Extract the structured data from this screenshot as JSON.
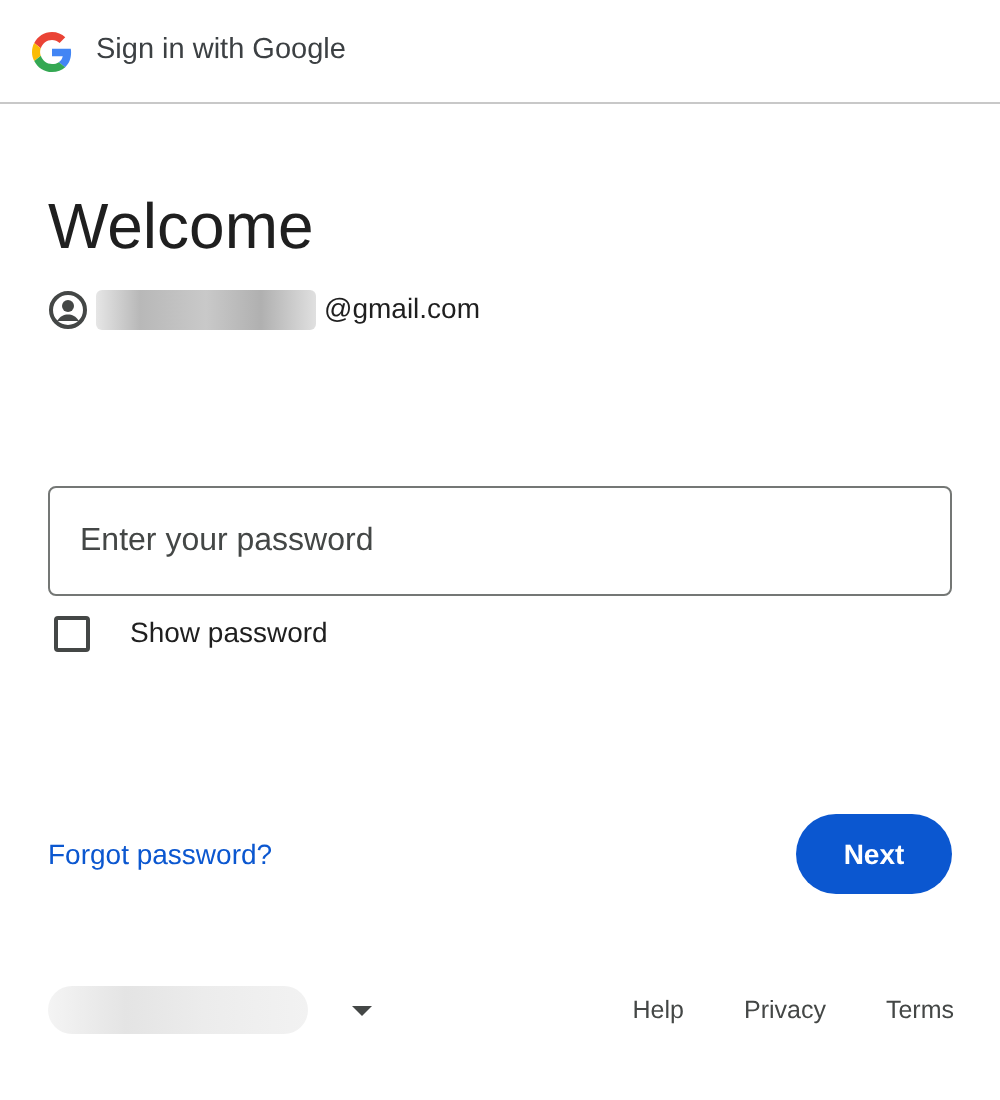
{
  "header": {
    "title": "Sign in with Google"
  },
  "heading": "Welcome",
  "account": {
    "email_suffix": "@gmail.com"
  },
  "password_field": {
    "placeholder": "Enter your password"
  },
  "show_password": {
    "label": "Show password",
    "checked": false
  },
  "forgot_link": "Forgot password?",
  "next_button": "Next",
  "footer": {
    "links": [
      "Help",
      "Privacy",
      "Terms"
    ]
  }
}
